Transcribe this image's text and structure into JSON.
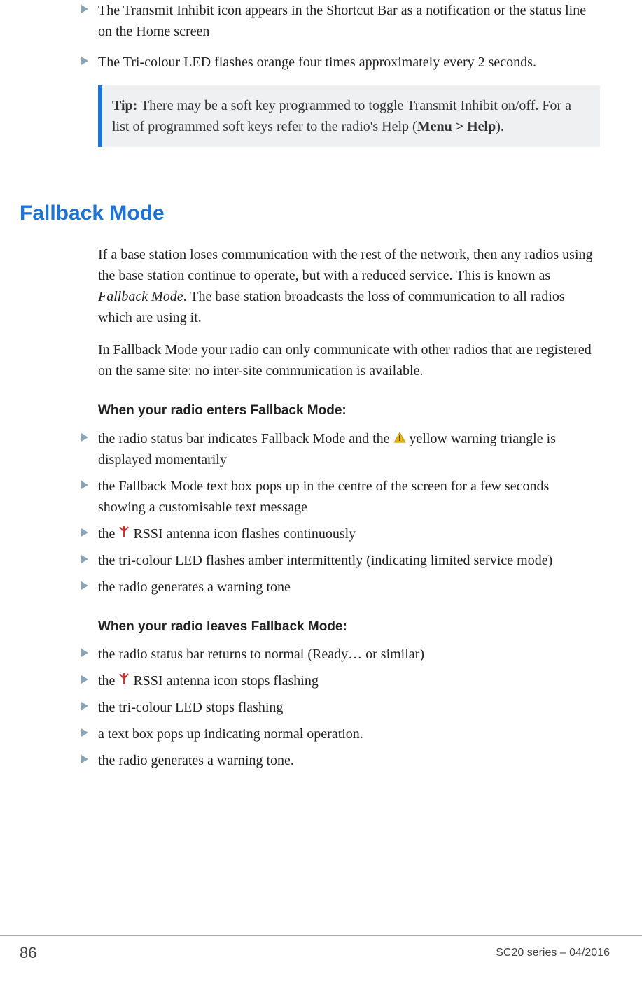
{
  "top_bullets": [
    "The Transmit Inhibit icon appears in the Shortcut Bar as a notification or the status line on the Home screen",
    "The Tri-colour LED flashes orange four times approximately every 2 seconds."
  ],
  "tip": {
    "label": "Tip:",
    "text_before": "  There may be a soft key programmed to toggle Transmit Inhibit on/off. For a list of programmed soft keys refer to the radio's Help (",
    "bold_menu": "Menu > Help",
    "text_after": ")."
  },
  "heading": "Fallback Mode",
  "paragraphs": {
    "p1_before": "If a base station loses communication with the rest of the network, then any radios using the base station continue to operate, but with a reduced service. This is known as ",
    "p1_italic": "Fallback Mode",
    "p1_after": ". The base station broadcasts the loss of communication to all radios which are using it.",
    "p2": "In Fallback Mode your radio can only communicate with other radios that are registered on the same site: no inter-site communication is available."
  },
  "enter": {
    "heading": "When your radio enters Fallback Mode:",
    "b1_before": "the radio status bar indicates Fallback Mode and the ",
    "b1_after": " yellow warning triangle is displayed momentarily",
    "b2": "the Fallback Mode text box pops up in the centre of the screen for a few seconds showing a customisable text message",
    "b3_before": "the ",
    "b3_after": " RSSI antenna icon flashes continuously",
    "b4": "the tri-colour LED flashes amber intermittently (indicating limited service mode)",
    "b5": "the radio generates a warning tone"
  },
  "leave": {
    "heading": "When your radio leaves Fallback Mode:",
    "b1": "the radio status bar returns to normal (Ready… or similar)",
    "b2_before": "the ",
    "b2_after": " RSSI antenna icon stops flashing",
    "b3": "the tri-colour LED stops flashing",
    "b4": "a text box pops up indicating normal operation.",
    "b5": "the radio generates a warning tone."
  },
  "footer": {
    "page": "86",
    "right": "SC20 series – 04/2016"
  }
}
